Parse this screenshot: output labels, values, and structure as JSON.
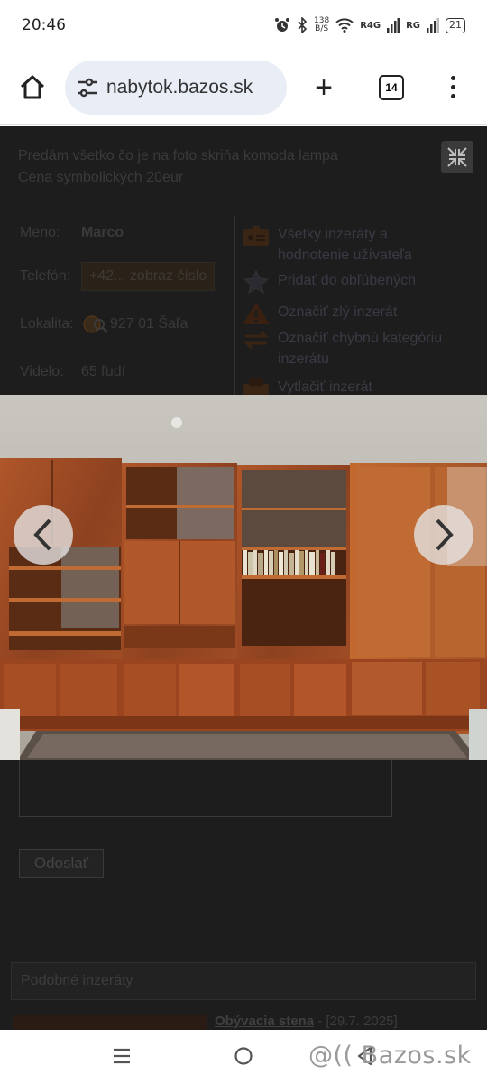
{
  "status": {
    "time": "20:46",
    "net_speed_top": "138",
    "net_speed_bottom": "B/S",
    "sig1": "R4G",
    "sig2": "RG",
    "battery": "21"
  },
  "browser": {
    "url": "nabytok.bazos.sk",
    "tab_count": "14"
  },
  "listing": {
    "description_line1": "Predám všetko čo je na foto skriňa komoda lampa",
    "description_line2": "Cena symbolických 20eur",
    "name_label": "Meno:",
    "name_value": "Marco",
    "phone_label": "Telefón:",
    "phone_button": "+42... zobraz číslo",
    "location_label": "Lokalita:",
    "location_value": "927 01 Šaľa",
    "views_label": "Videlo:",
    "views_value": "65 ľudí"
  },
  "actions": {
    "all_ads_line1": "Všetky inzeráty a",
    "all_ads_line2": "hodnotenie užívateľa",
    "favorite": "Pridať do obľúbených",
    "report": "Označiť zlý inzerát",
    "wrong_cat_line1": "Označiť chybnú kategóriu",
    "wrong_cat_line2": "inzerátu",
    "print": "Vytlačiť inzerát"
  },
  "form": {
    "send_button": "Odoslať"
  },
  "similar": {
    "heading": "Podobné inzeráty",
    "item_title": "Obývacia stena",
    "item_date": " - [29.7. 2025]"
  },
  "watermark": "@(( Bazos.sk",
  "colors": {
    "overlay_bg": "#1d1d1d",
    "wood": "#9a4a1f",
    "url_bar": "#e9edf5"
  }
}
